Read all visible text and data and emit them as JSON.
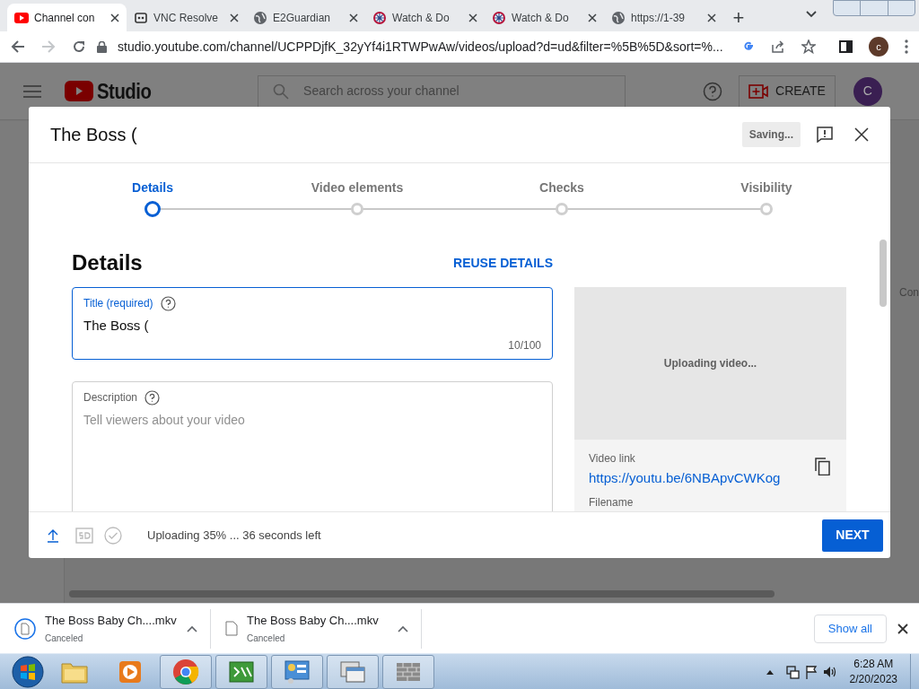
{
  "browser": {
    "tabs": [
      {
        "title": "Channel con",
        "kind": "youtube",
        "selected": true
      },
      {
        "title": "VNC Resolve",
        "kind": "vnc",
        "selected": false
      },
      {
        "title": "E2Guardian",
        "kind": "globe",
        "selected": false
      },
      {
        "title": "Watch & Do",
        "kind": "wheel",
        "selected": false
      },
      {
        "title": "Watch & Do",
        "kind": "wheel",
        "selected": false
      },
      {
        "title": "https://1-39",
        "kind": "globe",
        "selected": false
      }
    ],
    "new_tab": "+",
    "url": "studio.youtube.com/channel/UCPPDjfK_32yYf4i1RTWPwAw/videos/upload?d=ud&filter=%5B%5D&sort=%...",
    "profile": "c"
  },
  "studio": {
    "logo": "Studio",
    "search_placeholder": "Search across your channel",
    "create": "CREATE",
    "avatar": "C",
    "side_text": "Con"
  },
  "dialog": {
    "title": "The Boss (",
    "saving": "Saving...",
    "steps": [
      {
        "label": "Details",
        "selected": true
      },
      {
        "label": "Video elements",
        "selected": false
      },
      {
        "label": "Checks",
        "selected": false
      },
      {
        "label": "Visibility",
        "selected": false
      }
    ],
    "heading": "Details",
    "reuse": "REUSE DETAILS",
    "title_field": {
      "label": "Title (required)",
      "value": "The Boss (",
      "counter": "10/100"
    },
    "description_field": {
      "label": "Description",
      "placeholder": "Tell viewers about your video"
    },
    "preview_status": "Uploading video...",
    "video_link": {
      "label": "Video link",
      "url": "https://youtu.be/6NBApvCWKog"
    },
    "filename_label": "Filename",
    "upload_status": "Uploading 35% ... 36 seconds left",
    "next": "NEXT"
  },
  "downloads": {
    "items": [
      {
        "name": "The Boss Baby Ch....mkv",
        "status": "Canceled"
      },
      {
        "name": "The Boss Baby Ch....mkv",
        "status": "Canceled"
      }
    ],
    "show_all": "Show all"
  },
  "taskbar": {
    "time": "6:28 AM",
    "date": "2/20/2023"
  }
}
